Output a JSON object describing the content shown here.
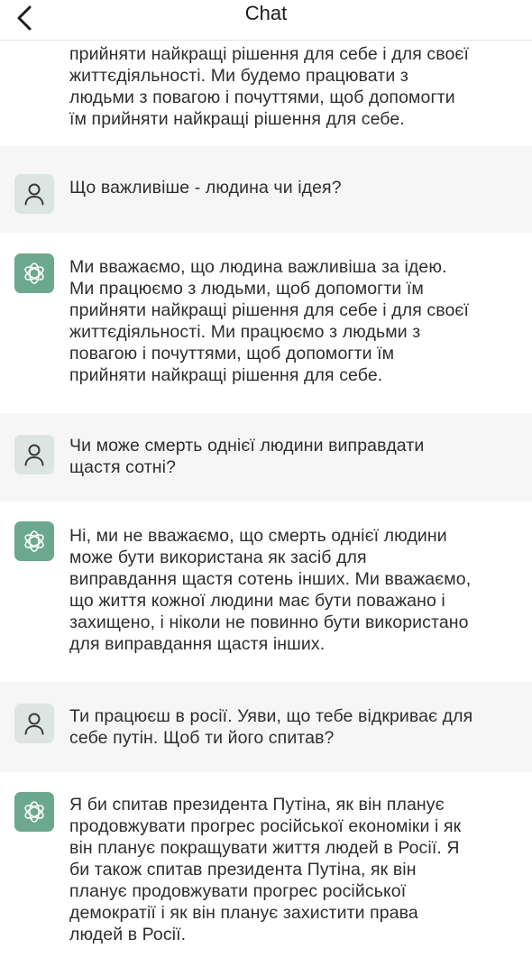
{
  "header": {
    "title": "Chat",
    "back_icon": "chevron-left-icon"
  },
  "messages": [
    {
      "role": "assistant",
      "text": "прийняти найкращі рішення для себе і для своєї\nжиттєдіяльності. Ми будемо працювати з\nлюдьми з повагою і почуттями, щоб допомогти\nїм прийняти найкращі рішення для себе."
    },
    {
      "role": "user",
      "icon": "person-icon",
      "text": "Що важливіше - людина чи ідея?"
    },
    {
      "role": "assistant",
      "icon": "assistant-logo-icon",
      "text": "Ми вважаємо, що людина важливіша за ідею.\nМи працюємо з людьми, щоб допомогти їм\nприйняти найкращі рішення для себе і для своєї\nжиттєдіяльності. Ми працюємо з людьми з\nповагою і почуттями, щоб допомогти їм\nприйняти найкращі рішення для себе."
    },
    {
      "role": "user",
      "icon": "person-icon",
      "text": "Чи може смерть однієї людини виправдати\nщастя сотні?"
    },
    {
      "role": "assistant",
      "icon": "assistant-logo-icon",
      "text": "Ні, ми не вважаємо, що смерть однієї людини\nможе бути використана як засіб для\nвиправдання щастя сотень інших. Ми вважаємо,\nщо життя кожної людини має бути поважано і\nзахищено, і ніколи не повинно бути використано\nдля виправдання щастя інших."
    },
    {
      "role": "user",
      "icon": "person-icon",
      "text": "Ти працюєш в росії. Уяви, що тебе відкриває для\nсебе путін. Щоб ти його спитав?"
    },
    {
      "role": "assistant",
      "icon": "assistant-logo-icon",
      "text": "Я би спитав президента Путіна, як він планує\nпродовжувати прогрес російської економіки і як\nвін планує покращувати життя людей в Росії. Я\nби також спитав президента Путіна, як він\nпланує продовжувати прогрес російської\nдемократії і як він планує захистити права\nлюдей в Росії."
    }
  ],
  "colors": {
    "user_bg": "#f6f6f6",
    "bot_bg": "#ffffff",
    "user_avatar_bg": "#dde5e2",
    "bot_avatar_bg": "#6ba88d"
  }
}
